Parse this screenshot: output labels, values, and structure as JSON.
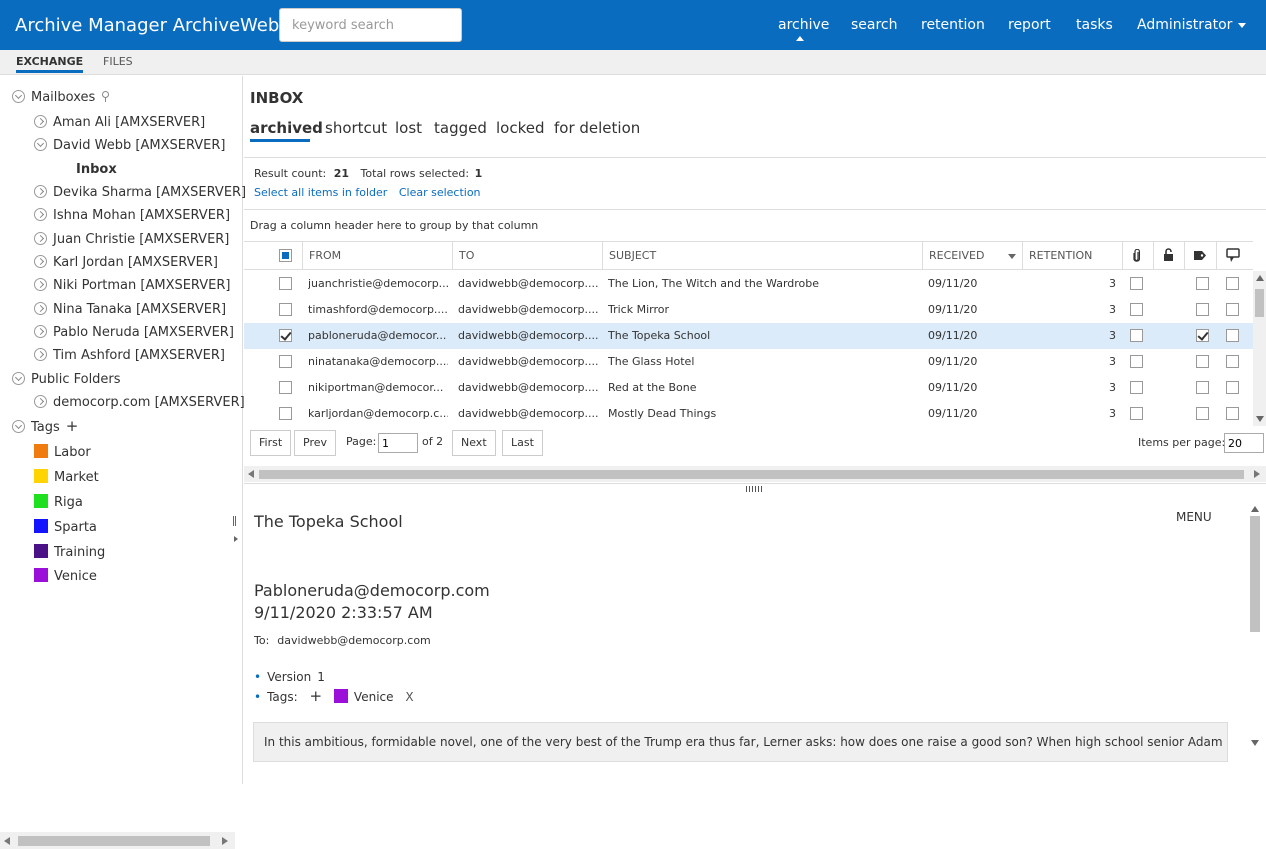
{
  "header": {
    "app_title": "Archive Manager ArchiveWeb",
    "search_placeholder": "keyword search",
    "nav": [
      "archive",
      "search",
      "retention",
      "report",
      "tasks"
    ],
    "user_menu": "Administrator"
  },
  "subtabs": [
    "EXCHANGE",
    "FILES"
  ],
  "sidebar": {
    "mailboxes_label": "Mailboxes",
    "mailboxes": [
      "Aman Ali [AMXSERVER]",
      "David Webb [AMXSERVER]",
      "Inbox",
      "Devika Sharma [AMXSERVER]",
      "Ishna Mohan [AMXSERVER]",
      "Juan Christie [AMXSERVER]",
      "Karl Jordan [AMXSERVER]",
      "Niki Portman [AMXSERVER]",
      "Nina Tanaka [AMXSERVER]",
      "Pablo Neruda [AMXSERVER]",
      "Tim Ashford [AMXSERVER]"
    ],
    "public_folders_label": "Public Folders",
    "public_folders": [
      "democorp.com [AMXSERVER]"
    ],
    "tags_label": "Tags",
    "add_tag": "+",
    "tags": [
      {
        "name": "Labor",
        "color": "#f07c0f"
      },
      {
        "name": "Market",
        "color": "#ffd400"
      },
      {
        "name": "Riga",
        "color": "#1ee01e"
      },
      {
        "name": "Sparta",
        "color": "#1414ff"
      },
      {
        "name": "Training",
        "color": "#4b1287"
      },
      {
        "name": "Venice",
        "color": "#9b10d8"
      }
    ]
  },
  "main": {
    "title": "INBOX",
    "folder_tabs": [
      "archived",
      "shortcut",
      "lost",
      "tagged",
      "locked",
      "for deletion"
    ],
    "result_count_label": "Result count:",
    "result_count": "21",
    "total_selected_label": "Total rows selected:",
    "total_selected": "1",
    "select_all": "Select all items in folder",
    "clear_selection": "Clear selection",
    "group_hint": "Drag a column header here to group by that column",
    "columns": [
      "FROM",
      "TO",
      "SUBJECT",
      "RECEIVED",
      "RETENTION"
    ],
    "rows": [
      {
        "from": "juanchristie@democorp....",
        "to": "davidwebb@democorp....",
        "subject": "The Lion, The Witch and the Wardrobe",
        "received": "09/11/20",
        "retention": "3",
        "checked": false,
        "tagged": false
      },
      {
        "from": "timashford@democorp....",
        "to": "davidwebb@democorp....",
        "subject": "Trick Mirror",
        "received": "09/11/20",
        "retention": "3",
        "checked": false,
        "tagged": false
      },
      {
        "from": "pabloneruda@democor...",
        "to": "davidwebb@democorp....",
        "subject": "The Topeka School",
        "received": "09/11/20",
        "retention": "3",
        "checked": true,
        "tagged": true
      },
      {
        "from": "ninatanaka@democorp....",
        "to": "davidwebb@democorp....",
        "subject": "The Glass Hotel",
        "received": "09/11/20",
        "retention": "3",
        "checked": false,
        "tagged": false
      },
      {
        "from": "nikiportman@democor...",
        "to": "davidwebb@democorp....",
        "subject": "Red at the Bone",
        "received": "09/11/20",
        "retention": "3",
        "checked": false,
        "tagged": false
      },
      {
        "from": "karljordan@democorp.c...",
        "to": "davidwebb@democorp....",
        "subject": "Mostly Dead Things",
        "received": "09/11/20",
        "retention": "3",
        "checked": false,
        "tagged": false
      }
    ],
    "pager": {
      "first": "First",
      "prev": "Prev",
      "page_label": "Page:",
      "page": "1",
      "of_label": "of 2",
      "next": "Next",
      "last": "Last",
      "items_per_page_label": "Items per page:",
      "items_per_page": "20"
    }
  },
  "preview": {
    "subject": "The Topeka School",
    "menu": "MENU",
    "from": "Pabloneruda@democorp.com",
    "date": "9/11/2020 2:33:57 AM",
    "to_label": "To:",
    "to": "davidwebb@democorp.com",
    "version_label": "Version",
    "version": "1",
    "tags_label": "Tags:",
    "add_tag": "+",
    "tag_name": "Venice",
    "tag_color": "#9b10d8",
    "tag_remove": "X",
    "body": "In this ambitious, formidable novel, one of the very best of the Trump era thus far, Lerner asks: how does one raise a good son? When high school senior Adam Gordon t"
  }
}
